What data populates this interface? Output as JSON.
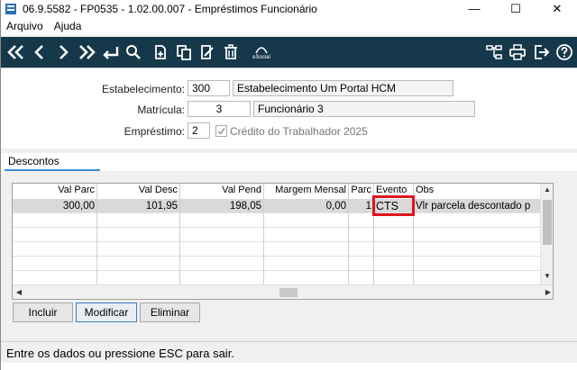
{
  "window": {
    "title": "06.9.5582 - FP0535 - 1.02.00.007 - Empréstimos Funcionário",
    "minimize": "—",
    "maximize": "☐",
    "close": "✕"
  },
  "menu": {
    "items": [
      "Arquivo",
      "Ajuda"
    ]
  },
  "toolbar": {
    "icons": [
      "first-icon",
      "prev-icon",
      "next-icon",
      "last-icon",
      "return-icon",
      "search-icon",
      "new-doc-icon",
      "copy-icon",
      "edit-icon",
      "delete-icon",
      "esocial-icon",
      "hierarchy-icon",
      "print-icon",
      "exit-icon",
      "help-icon"
    ],
    "esocial_label": "eSocial",
    "color": "#15384a"
  },
  "form": {
    "estabelecimento_label": "Estabelecimento:",
    "estabelecimento_code": "300",
    "estabelecimento_name": "Estabelecimento Um Portal HCM",
    "matricula_label": "Matrícula:",
    "matricula_value": "3",
    "matricula_name": "Funcionário 3",
    "emprestimo_label": "Empréstimo:",
    "emprestimo_value": "2",
    "credito_label": "Crédito do Trabalhador 2025",
    "credito_checked": true
  },
  "tabs": {
    "descontos": "Descontos"
  },
  "grid": {
    "headers": {
      "val_parc": "Val Parc",
      "val_desc": "Val Desc",
      "val_pend": "Val Pend",
      "margem": "Margem Mensal",
      "parc": "Parc",
      "evento": "Evento",
      "obs": "Obs"
    },
    "row": {
      "val_parc": "300,00",
      "val_desc": "101,95",
      "val_pend": "198,05",
      "margem": "0,00",
      "parc": "1",
      "evento": "CTS",
      "obs": "Vlr parcela descontado p"
    },
    "highlight_color": "#e0141e"
  },
  "buttons": {
    "incluir": "Incluir",
    "modificar": "Modificar",
    "eliminar": "Eliminar"
  },
  "status": {
    "message": "Entre os dados ou pressione ESC para sair."
  }
}
